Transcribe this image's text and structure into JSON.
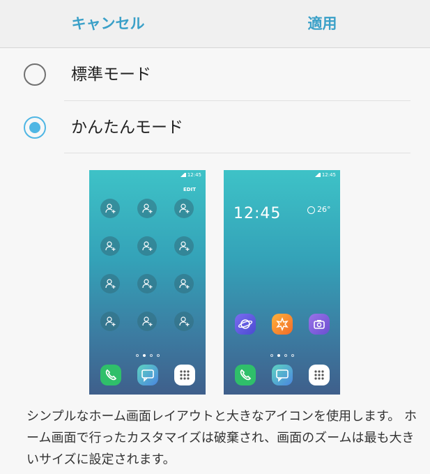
{
  "header": {
    "cancel_label": "キャンセル",
    "apply_label": "適用",
    "accent_color": "#3aa0c8"
  },
  "options": [
    {
      "label": "標準モード",
      "selected": false
    },
    {
      "label": "かんたんモード",
      "selected": true
    }
  ],
  "preview": {
    "left_phone": {
      "status_time": "12:45",
      "edit_label": "EDIT",
      "contact_placeholder_icon": "add-contact-icon",
      "dock": [
        "phone-icon",
        "messages-icon",
        "apps-icon"
      ]
    },
    "right_phone": {
      "status_time": "12:45",
      "clock": "12:45",
      "temperature": "26°",
      "apps": [
        "internet-icon",
        "galaxy-apps-icon",
        "camera-icon"
      ],
      "dock": [
        "phone-icon",
        "messages-icon",
        "apps-icon"
      ]
    }
  },
  "description": "シンプルなホーム画面レイアウトと大きなアイコンを使用します。 ホーム画面で行ったカスタマイズは破棄され、画面のズームは最も大きいサイズに設定されます。"
}
